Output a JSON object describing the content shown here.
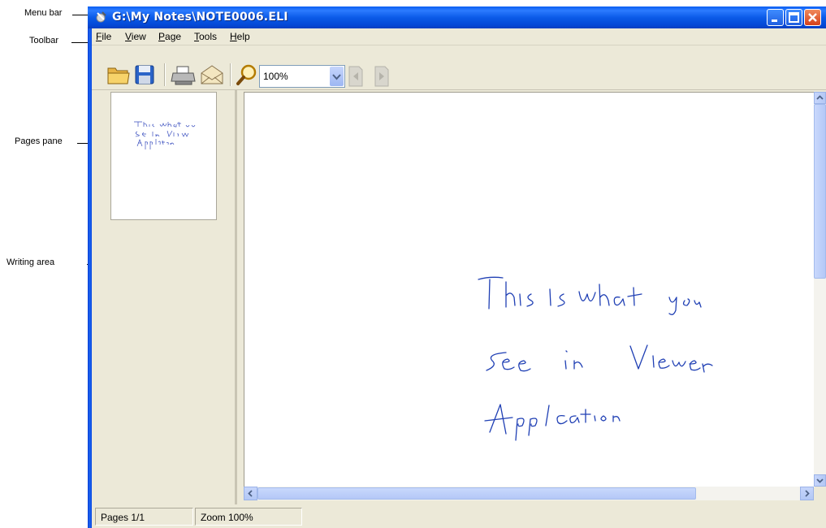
{
  "callouts": {
    "menu_bar": "Menu bar",
    "toolbar": "Toolbar",
    "pages_pane": "Pages pane",
    "writing_area": "Writing area"
  },
  "window": {
    "title": "G:\\My Notes\\NOTE0006.ELI",
    "app_icon": "pen-app-icon",
    "controls": [
      "minimize-icon",
      "maximize-icon",
      "close-icon"
    ]
  },
  "menu": [
    {
      "hotkey": "F",
      "rest": "ile"
    },
    {
      "hotkey": "V",
      "rest": "iew"
    },
    {
      "hotkey": "P",
      "rest": "age"
    },
    {
      "hotkey": "T",
      "rest": "ools"
    },
    {
      "hotkey": "H",
      "rest": "elp"
    }
  ],
  "toolbar": {
    "tools": [
      "open-folder-icon",
      "save-icon",
      "print-icon",
      "email-icon",
      "zoom-icon",
      "previous-page-icon",
      "next-page-icon"
    ],
    "zoom_value": "100%"
  },
  "note": {
    "lines": [
      "This is what you",
      "See in Viewer",
      "Applcation"
    ]
  },
  "status": {
    "pages": "Pages 1/1",
    "zoom": "Zoom 100%"
  },
  "colors": {
    "titlebar": "#0a5ef2",
    "ink": "#1f3fb4",
    "chrome": "#ece9d8"
  }
}
